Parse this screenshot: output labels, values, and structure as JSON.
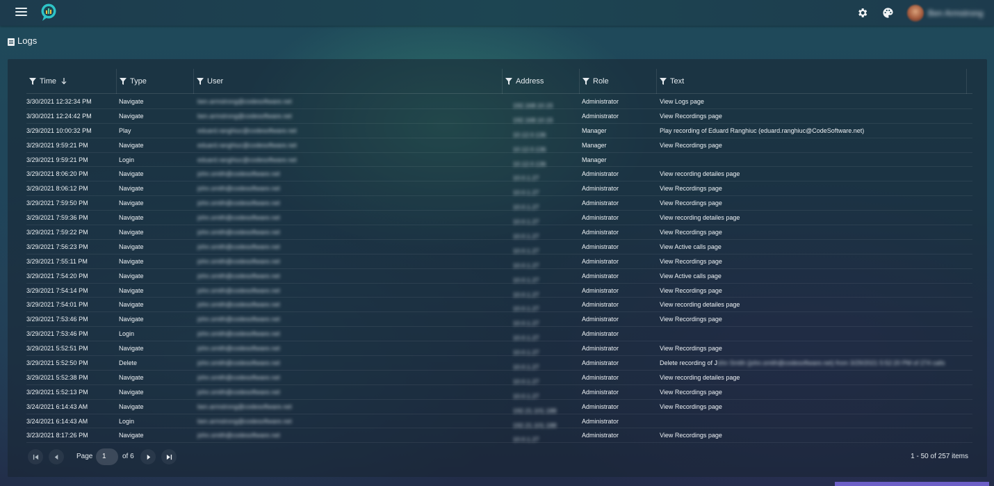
{
  "header": {
    "user_name": "Ben Armstrong",
    "logo": "app-logo",
    "icons": [
      "menu-icon",
      "gear-icon",
      "palette-icon"
    ]
  },
  "page": {
    "title": "Logs"
  },
  "grid": {
    "columns": [
      {
        "label": "Time",
        "sorted": "descending"
      },
      {
        "label": "Type"
      },
      {
        "label": "User"
      },
      {
        "label": "Address"
      },
      {
        "label": "Role"
      },
      {
        "label": "Text"
      }
    ],
    "rows": [
      {
        "time": "3/30/2021 12:32:34 PM",
        "type": "Navigate",
        "user": "ben.armstrong@codesoftware.net",
        "address": "192.168.10.15",
        "role": "Administrator",
        "text": "View Logs page",
        "text_extra": ""
      },
      {
        "time": "3/30/2021 12:24:42 PM",
        "type": "Navigate",
        "user": "ben.armstrong@codesoftware.net",
        "address": "192.168.10.15",
        "role": "Administrator",
        "text": "View Recordings page",
        "text_extra": ""
      },
      {
        "time": "3/29/2021 10:00:32 PM",
        "type": "Play",
        "user": "eduard.ranghiuc@codesoftware.net",
        "address": "10.12.0.136",
        "role": "Manager",
        "text": "Play recording of Eduard Ranghiuc (eduard.ranghiuc@CodeSoftware.net)",
        "text_extra": ""
      },
      {
        "time": "3/29/2021 9:59:21 PM",
        "type": "Navigate",
        "user": "eduard.ranghiuc@codesoftware.net",
        "address": "10.12.0.136",
        "role": "Manager",
        "text": "View Recordings page",
        "text_extra": ""
      },
      {
        "time": "3/29/2021 9:59:21 PM",
        "type": "Login",
        "user": "eduard.ranghiuc@codesoftware.net",
        "address": "10.12.0.136",
        "role": "Manager",
        "text": "",
        "text_extra": ""
      },
      {
        "time": "3/29/2021 8:06:20 PM",
        "type": "Navigate",
        "user": "john.smith@codesoftware.net",
        "address": "10.0.1.27",
        "role": "Administrator",
        "text": "View recording detailes page",
        "text_extra": ""
      },
      {
        "time": "3/29/2021 8:06:12 PM",
        "type": "Navigate",
        "user": "john.smith@codesoftware.net",
        "address": "10.0.1.27",
        "role": "Administrator",
        "text": "View Recordings page",
        "text_extra": ""
      },
      {
        "time": "3/29/2021 7:59:50 PM",
        "type": "Navigate",
        "user": "john.smith@codesoftware.net",
        "address": "10.0.1.27",
        "role": "Administrator",
        "text": "View Recordings page",
        "text_extra": ""
      },
      {
        "time": "3/29/2021 7:59:36 PM",
        "type": "Navigate",
        "user": "john.smith@codesoftware.net",
        "address": "10.0.1.27",
        "role": "Administrator",
        "text": "View recording detailes page",
        "text_extra": ""
      },
      {
        "time": "3/29/2021 7:59:22 PM",
        "type": "Navigate",
        "user": "john.smith@codesoftware.net",
        "address": "10.0.1.27",
        "role": "Administrator",
        "text": "View Recordings page",
        "text_extra": ""
      },
      {
        "time": "3/29/2021 7:56:23 PM",
        "type": "Navigate",
        "user": "john.smith@codesoftware.net",
        "address": "10.0.1.27",
        "role": "Administrator",
        "text": "View Active calls page",
        "text_extra": ""
      },
      {
        "time": "3/29/2021 7:55:11 PM",
        "type": "Navigate",
        "user": "john.smith@codesoftware.net",
        "address": "10.0.1.27",
        "role": "Administrator",
        "text": "View Recordings page",
        "text_extra": ""
      },
      {
        "time": "3/29/2021 7:54:20 PM",
        "type": "Navigate",
        "user": "john.smith@codesoftware.net",
        "address": "10.0.1.27",
        "role": "Administrator",
        "text": "View Active calls page",
        "text_extra": ""
      },
      {
        "time": "3/29/2021 7:54:14 PM",
        "type": "Navigate",
        "user": "john.smith@codesoftware.net",
        "address": "10.0.1.27",
        "role": "Administrator",
        "text": "View Recordings page",
        "text_extra": ""
      },
      {
        "time": "3/29/2021 7:54:01 PM",
        "type": "Navigate",
        "user": "john.smith@codesoftware.net",
        "address": "10.0.1.27",
        "role": "Administrator",
        "text": "View recording detailes page",
        "text_extra": ""
      },
      {
        "time": "3/29/2021 7:53:46 PM",
        "type": "Navigate",
        "user": "john.smith@codesoftware.net",
        "address": "10.0.1.27",
        "role": "Administrator",
        "text": "View Recordings page",
        "text_extra": ""
      },
      {
        "time": "3/29/2021 7:53:46 PM",
        "type": "Login",
        "user": "john.smith@codesoftware.net",
        "address": "10.0.1.27",
        "role": "Administrator",
        "text": "",
        "text_extra": ""
      },
      {
        "time": "3/29/2021 5:52:51 PM",
        "type": "Navigate",
        "user": "john.smith@codesoftware.net",
        "address": "10.0.1.27",
        "role": "Administrator",
        "text": "View Recordings page",
        "text_extra": ""
      },
      {
        "time": "3/29/2021 5:52:50 PM",
        "type": "Delete",
        "user": "john.smith@codesoftware.net",
        "address": "10.0.1.27",
        "role": "Administrator",
        "text": "Delete recording of J",
        "text_extra": "ohn Smith (john.smith@codesoftware.net) from 3/29/2021 5:52:20 PM of 274 calls"
      },
      {
        "time": "3/29/2021 5:52:38 PM",
        "type": "Navigate",
        "user": "john.smith@codesoftware.net",
        "address": "10.0.1.27",
        "role": "Administrator",
        "text": "View recording detailes page",
        "text_extra": ""
      },
      {
        "time": "3/29/2021 5:52:13 PM",
        "type": "Navigate",
        "user": "john.smith@codesoftware.net",
        "address": "10.0.1.27",
        "role": "Administrator",
        "text": "View Recordings page",
        "text_extra": ""
      },
      {
        "time": "3/24/2021 6:14:43 AM",
        "type": "Navigate",
        "user": "ben.armstrong@codesoftware.net",
        "address": "192.21.101.188",
        "role": "Administrator",
        "text": "View Recordings page",
        "text_extra": ""
      },
      {
        "time": "3/24/2021 6:14:43 AM",
        "type": "Login",
        "user": "ben.armstrong@codesoftware.net",
        "address": "192.21.101.188",
        "role": "Administrator",
        "text": "",
        "text_extra": ""
      },
      {
        "time": "3/23/2021 8:17:26 PM",
        "type": "Navigate",
        "user": "john.smith@codesoftware.net",
        "address": "10.0.1.27",
        "role": "Administrator",
        "text": "View Recordings page",
        "text_extra": ""
      }
    ]
  },
  "pager": {
    "page_label": "Page",
    "current_page": "1",
    "of_label": "of 6",
    "items_info": "1 - 50 of 257 items"
  },
  "colors": {
    "accent": "#6c5fc7",
    "logo": "#2ec4c7",
    "background_top": "#1d3b4d"
  }
}
